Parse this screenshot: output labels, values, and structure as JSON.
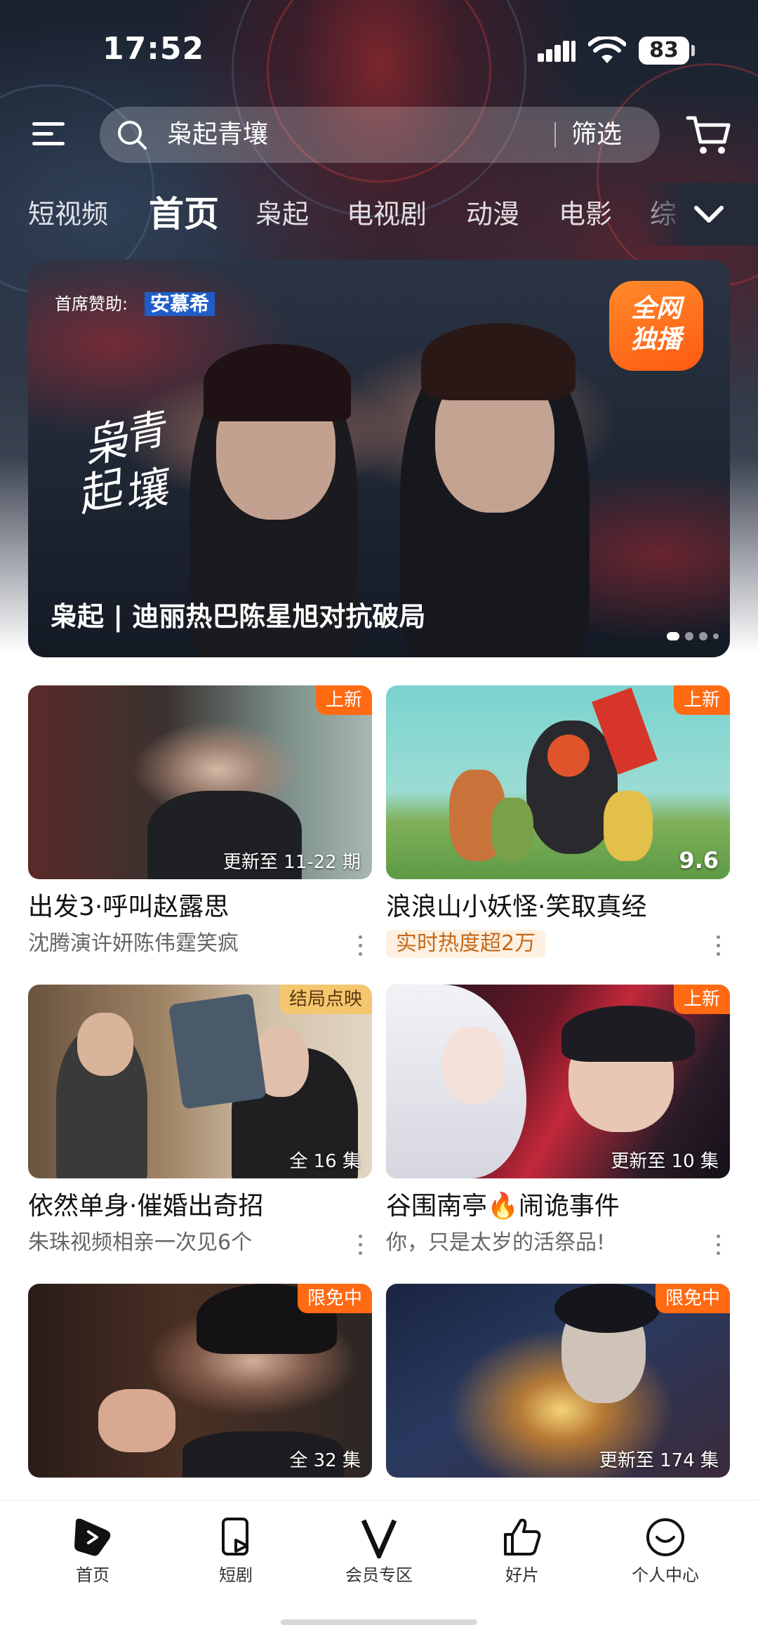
{
  "status_bar": {
    "time": "17:52",
    "battery": "83"
  },
  "search": {
    "query": "枭起青壤",
    "filter_label": "筛选"
  },
  "tabs": [
    "短视频",
    "首页",
    "枭起",
    "电视剧",
    "动漫",
    "电影",
    "综"
  ],
  "active_tab": "首页",
  "banner": {
    "sponsor_label": "首席赞助:",
    "sponsor_brand": "安慕希",
    "show_logo": "枭起青壤",
    "badge_line1": "全网",
    "badge_line2": "独播",
    "caption": "枭起 | 迪丽热巴陈星旭对抗破局",
    "slide_count": 4,
    "active_slide": 1
  },
  "cards": [
    {
      "title": "出发3·呼叫赵露思",
      "subtitle": "沈腾演许妍陈伟霆笑疯",
      "badge": "上新",
      "meta": "更新至 11-22 期"
    },
    {
      "title": "浪浪山小妖怪·笑取真经",
      "subtitle": "实时热度超2万",
      "badge": "上新",
      "meta": "9.6"
    },
    {
      "title": "依然单身·催婚出奇招",
      "subtitle": "朱珠视频相亲一次见6个",
      "badge": "结局点映",
      "meta": "全 16 集"
    },
    {
      "title": "谷围南亭🔥闹诡事件",
      "subtitle": "你，只是太岁的活祭品!",
      "badge": "上新",
      "meta": "更新至 10 集"
    },
    {
      "title": "",
      "subtitle": "",
      "badge": "限免中",
      "meta": "全 32 集"
    },
    {
      "title": "",
      "subtitle": "",
      "badge": "限免中",
      "meta": "更新至 174 集"
    }
  ],
  "bottom_nav": [
    {
      "label": "首页",
      "icon": "play-logo-icon"
    },
    {
      "label": "短剧",
      "icon": "short-drama-icon"
    },
    {
      "label": "会员专区",
      "icon": "vip-v-icon"
    },
    {
      "label": "好片",
      "icon": "thumbs-up-icon"
    },
    {
      "label": "个人中心",
      "icon": "smiley-icon"
    }
  ],
  "colors": {
    "accent": "#ff6a13",
    "gold_badge": "#f4c66e",
    "sponsor_blue": "#1f5ec9"
  }
}
